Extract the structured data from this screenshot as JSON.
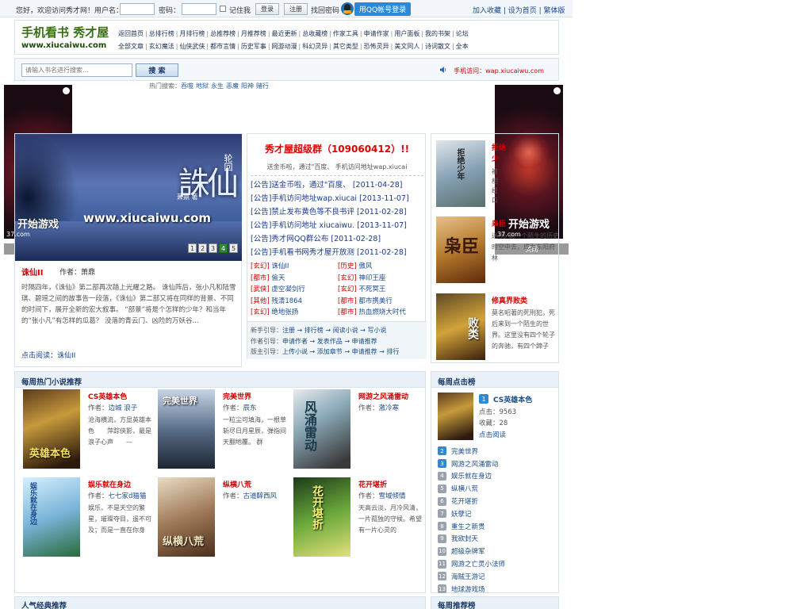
{
  "topbar": {
    "welcome": "您好，欢迎访问秀才网！用户名：",
    "password_label": "密码：",
    "remember": "记住我",
    "login": "登录",
    "register": "注册",
    "find_password": "找回密码",
    "qq_login": "用QQ帐号登录",
    "right_links": "加入收藏 | 设为首页 | 繁体版"
  },
  "header": {
    "logo_line1": "手机看书 秀才屋",
    "logo_line2": "www.xiucaiwu.com",
    "nav_row1": [
      "返回首页",
      "总排行榜",
      "月排行榜",
      "总推荐榜",
      "月推荐榜",
      "最近更新",
      "总收藏榜",
      "作家工具",
      "申请作家",
      "用户面板",
      "我的书架",
      "论坛"
    ],
    "nav_row2": [
      "全部文章",
      "玄幻魔法",
      "仙侠武侠",
      "都市言情",
      "历史军事",
      "网游动漫",
      "科幻灵异",
      "其它类型",
      "恐怖灵异",
      "美文同人",
      "诗词散文",
      "全本"
    ]
  },
  "search": {
    "placeholder": "请输入书名进行搜索...",
    "button": "搜 索",
    "mobile": "手机访问：wap.xiucaiwu.com",
    "hot_label": "热门搜索：",
    "hot_terms": [
      "吞噬",
      "地狱",
      "永生",
      "恶魔",
      "阳神",
      "赌行"
    ]
  },
  "ads": {
    "play": "开始游戏",
    "domain": "37.com",
    "close": "关闭"
  },
  "featured": {
    "banner_url": "www.xiucaiwu.com",
    "banner_title": "誅仙",
    "banner_sub": "轮回",
    "banner_author": "萧鼎 著",
    "pages": [
      "1",
      "2",
      "3",
      "4",
      "5"
    ],
    "active_page": "4",
    "title": "诛仙II",
    "author": "作者：萧鼎",
    "desc": "时隔四年，《诛仙》第二部再次踏上光耀之路。 诛仙阵后，张小凡和陆雪琪、碧瑶之间的故事告一段落，《诛仙》第二部又将在同样的背景、不同的时间下，展开全新的宏大叙事。 “部景”将是个怎样的少年？和当年的“张小凡”有怎样的瓜葛？ 没落的青云门、凶险的万妖谷...",
    "read_link": "点击阅读：诛仙II"
  },
  "notice": {
    "title": "秀才屋超级群（109060412）!!",
    "subtitle": "送金币啦，通过\"百度、 手机访问地址wap.xiucai",
    "items": [
      {
        "tag": "[公告]",
        "text": "送金币啦，通过\"百度、",
        "date": "[2011-04-28]"
      },
      {
        "tag": "[公告]",
        "text": "手机访问地址wap.xiucai",
        "date": "[2013-11-07]"
      },
      {
        "tag": "[公告]",
        "text": "禁止发布黄色等不良书评",
        "date": "[2011-02-28]"
      },
      {
        "tag": "[公告]",
        "text": "手机访问地址 xiucaiwu.",
        "date": "[2013-11-07]"
      },
      {
        "tag": "[公告]",
        "text": "秀才网QQ群公布",
        "date": "[2011-02-28]"
      },
      {
        "tag": "[公告]",
        "text": "手机看书网秀才屋开放测",
        "date": "[2011-02-28]"
      }
    ],
    "grid": [
      [
        {
          "cat": "[玄幻]",
          "book": "诛仙II"
        },
        {
          "cat": "[历史]",
          "book": "傲风"
        }
      ],
      [
        {
          "cat": "[都市]",
          "book": "偷天"
        },
        {
          "cat": "[玄幻]",
          "book": "神印王座"
        }
      ],
      [
        {
          "cat": "[武侠]",
          "book": "虚空凝剑行"
        },
        {
          "cat": "[玄幻]",
          "book": "不死冥王"
        }
      ],
      [
        {
          "cat": "[其他]",
          "book": "残清1864"
        },
        {
          "cat": "[都市]",
          "book": "都市携美行"
        }
      ],
      [
        {
          "cat": "[玄幻]",
          "book": "绝地张扬"
        },
        {
          "cat": "[都市]",
          "book": "热血燃烧大时代"
        }
      ]
    ],
    "guide": [
      {
        "label": "新手引导：",
        "links": "注册 → 排行榜 → 阅读小说 → 写小说"
      },
      {
        "label": "作者引导：",
        "links": "申请作者 → 发表作品 → 申请推荐"
      },
      {
        "label": "版主引导：",
        "links": "上传小说 → 添加章节 → 申请推荐 → 排行"
      }
    ]
  },
  "right_list": [
    {
      "title": "拒绝",
      "title2": "少",
      "desc": "被\n相\n经\n口"
    },
    {
      "title": "枭臣",
      "desc": "迷\n死\n到一个陌生的历史时空中去，成为东阳府林"
    },
    {
      "title": "修真界败类",
      "desc": "莫名昭著的死刑犯，死后来到一个陌生的世界。这里没有四个轮子的奔驰，有四个蹄子"
    }
  ],
  "weekly": {
    "heading": "每周热门小说推荐",
    "books": [
      {
        "title": "CS英雄本色",
        "author_label": "作者：",
        "author": "边城 浪子",
        "desc": "沧海横流，方显英雄本色　　萍踪侠影，最是浪子心声　　—",
        "cover_text": "英雄本色"
      },
      {
        "title": "完美世界",
        "author_label": "作者：",
        "author": "辰东",
        "desc": "一粒尘可填海，一根草斩尽日月星辰，弹指间天翻地覆。 群",
        "cover_text": "完美世界"
      },
      {
        "title": "网游之风涌雷动",
        "author_label": "作者：",
        "author": "激冷寒",
        "desc": "",
        "cover_text": "风涌雷动"
      },
      {
        "title": "娱乐就在身边",
        "author_label": "作者：",
        "author": "七七家d猫猫",
        "desc": "娱乐，不是天空的繁星，璀璨夺目，遥不可及；而是一直在你身",
        "cover_text": "娱乐就在身边"
      },
      {
        "title": "纵横八荒",
        "author_label": "作者：",
        "author": "古道醉西风",
        "desc": "",
        "cover_text": "纵横八荒"
      },
      {
        "title": "花开堪折",
        "author_label": "作者：",
        "author": "雪域倾情",
        "desc": "天高云淡，月冷风清，一片孤独的守候。希望有一片心灵的",
        "cover_text": "花开堪折"
      }
    ]
  },
  "rank": {
    "heading": "每周点击榜",
    "top": {
      "num": "1",
      "name": "CS英雄本色",
      "clicks": "点击：9563",
      "collect": "收藏：28",
      "read": "点击阅读"
    },
    "list": [
      {
        "num": "2",
        "name": "完美世界"
      },
      {
        "num": "3",
        "name": "网游之风涌雷动"
      },
      {
        "num": "4",
        "name": "娱乐就在身边"
      },
      {
        "num": "5",
        "name": "纵横八荒"
      },
      {
        "num": "6",
        "name": "花开堪折"
      },
      {
        "num": "7",
        "name": "妖孽记"
      },
      {
        "num": "8",
        "name": "重生之新贵"
      },
      {
        "num": "9",
        "name": "我欲封天"
      },
      {
        "num": "10",
        "name": "超级杂牌军"
      },
      {
        "num": "11",
        "name": "网游之亡灵小法师"
      },
      {
        "num": "12",
        "name": "海贼王游记"
      },
      {
        "num": "13",
        "name": "地球游戏场"
      }
    ]
  },
  "classic_heading": "人气经典推荐",
  "recommend_heading": "每周推荐榜"
}
